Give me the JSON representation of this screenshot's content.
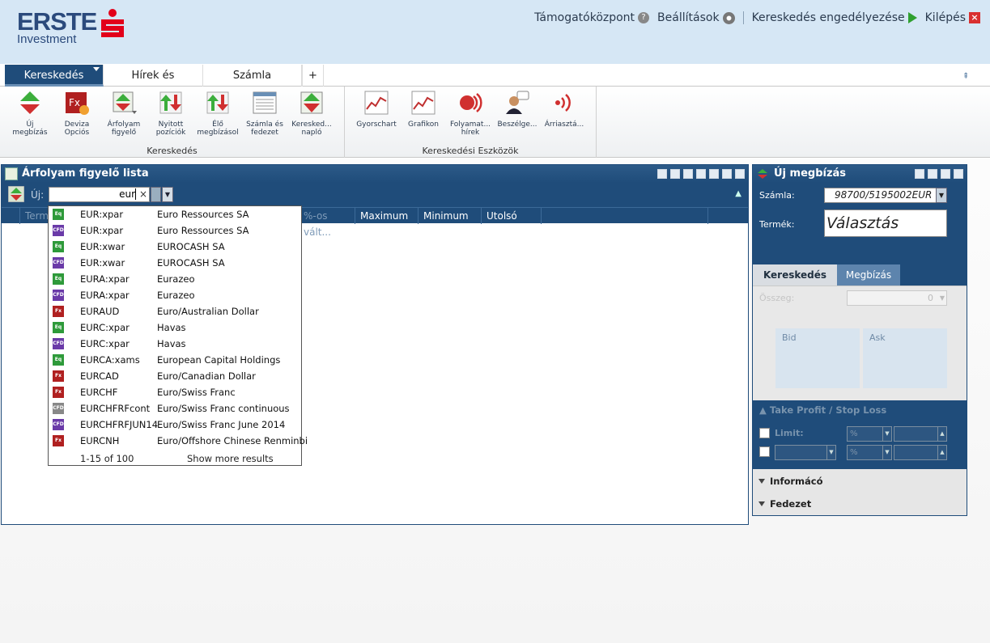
{
  "brand": {
    "name": "ERSTE",
    "sub": "Investment",
    "color": "#2b4a7c",
    "accent": "#e2001a"
  },
  "toplinks": {
    "support": "Támogatóközpont",
    "settings": "Beállítások",
    "authorize": "Kereskedés engedélyezése",
    "logout": "Kilépés"
  },
  "tabs": [
    "Kereskedés",
    "Hírek és",
    "Számla",
    "+"
  ],
  "ribbon": {
    "groups": [
      {
        "label": "Kereskedés",
        "buttons": [
          "Új\nmegbízás",
          "Deviza\nOpciós",
          "Árfolyam\nfigyelő",
          "Nyitott\npozíciók",
          "Élő\nmegbízásol",
          "Számla és\nfedezet",
          "Keresked...\nnapló"
        ]
      },
      {
        "label": "Kereskedési Eszközök",
        "buttons": [
          "Gyorschart",
          "Grafikon",
          "Folyamat...\nhírek",
          "Beszélge...",
          "Árriasztá..."
        ]
      }
    ]
  },
  "watchlist": {
    "title": "Árfolyam figyelő lista",
    "new_label": "Új:",
    "search_value": "eur",
    "clear_icon": "×",
    "columns": [
      "Term",
      "%-os vált...",
      "Maximum",
      "Minimum",
      "Utolsó fris..."
    ]
  },
  "dropdown": {
    "items": [
      {
        "type": "Eq",
        "symbol": "EUR:xpar",
        "name": "Euro Ressources SA"
      },
      {
        "type": "CFD",
        "symbol": "EUR:xpar",
        "name": "Euro Ressources SA"
      },
      {
        "type": "Eq",
        "symbol": "EUR:xwar",
        "name": "EUROCASH SA"
      },
      {
        "type": "CFD",
        "symbol": "EUR:xwar",
        "name": "EUROCASH SA"
      },
      {
        "type": "Eq",
        "symbol": "EURA:xpar",
        "name": "Eurazeo"
      },
      {
        "type": "CFD",
        "symbol": "EURA:xpar",
        "name": "Eurazeo"
      },
      {
        "type": "Fx",
        "symbol": "EURAUD",
        "name": "Euro/Australian Dollar"
      },
      {
        "type": "Eq",
        "symbol": "EURC:xpar",
        "name": "Havas"
      },
      {
        "type": "CFD",
        "symbol": "EURC:xpar",
        "name": "Havas"
      },
      {
        "type": "Eq",
        "symbol": "EURCA:xams",
        "name": "European Capital Holdings"
      },
      {
        "type": "Fx",
        "symbol": "EURCAD",
        "name": "Euro/Canadian Dollar"
      },
      {
        "type": "Fx",
        "symbol": "EURCHF",
        "name": "Euro/Swiss Franc"
      },
      {
        "type": "CFD",
        "symbol": "EURCHFRFcont",
        "name": "Euro/Swiss Franc continuous"
      },
      {
        "type": "CFD",
        "symbol": "EURCHFRFJUN14",
        "name": "Euro/Swiss Franc June 2014"
      },
      {
        "type": "Fx",
        "symbol": "EURCNH",
        "name": "Euro/Offshore Chinese Renminbi"
      }
    ],
    "count_text": "1-15 of 100",
    "more_text": "Show more results"
  },
  "order": {
    "title": "Új megbízás",
    "account_label": "Számla:",
    "account_value": "98700/5195002EUR",
    "product_label": "Termék:",
    "product_value": "Választás",
    "tab_trade": "Kereskedés",
    "tab_order": "Megbízás",
    "amount_label": "Összeg:",
    "amount_value": "0",
    "bid": "Bid",
    "ask": "Ask",
    "tpsl": "Take Profit / Stop Loss",
    "limit": "Limit:",
    "pct1": "%",
    "pct2": "%",
    "info": "Informácó",
    "margin": "Fedezet"
  }
}
